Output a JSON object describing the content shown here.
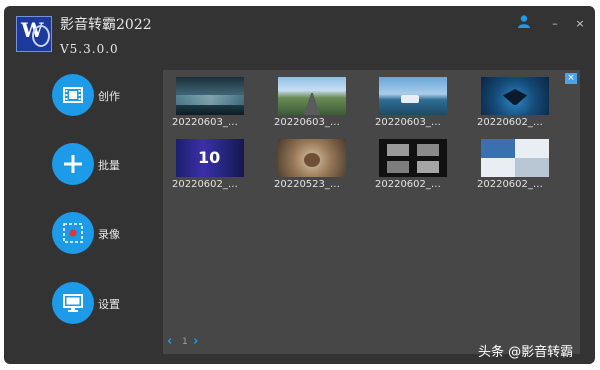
{
  "app": {
    "logo_letter": "W",
    "title": "影音转霸2022",
    "version": "V5.3.0.0"
  },
  "window_controls": {
    "user_icon": "user-icon",
    "minimize": "–",
    "close": "×"
  },
  "sidebar": {
    "items": [
      {
        "label": "创作",
        "icon": "film-strip-icon"
      },
      {
        "label": "批量",
        "icon": "plus-icon"
      },
      {
        "label": "录像",
        "icon": "record-screen-icon"
      },
      {
        "label": "设置",
        "icon": "monitor-icon"
      }
    ]
  },
  "gallery": {
    "close_label": "×",
    "items": [
      {
        "label": "20220603_…"
      },
      {
        "label": "20220603_…"
      },
      {
        "label": "20220603_…"
      },
      {
        "label": "20220602_…"
      },
      {
        "label": "20220602_…"
      },
      {
        "label": "20220523_…"
      },
      {
        "label": "20220602_…"
      },
      {
        "label": "20220602_…"
      }
    ],
    "pagination": {
      "prev": "‹",
      "page": "1",
      "next": "›"
    }
  },
  "watermark": "头条 @影音转霸",
  "colors": {
    "accent": "#1d9be8",
    "window_bg": "#333333",
    "panel_bg": "#474747"
  }
}
